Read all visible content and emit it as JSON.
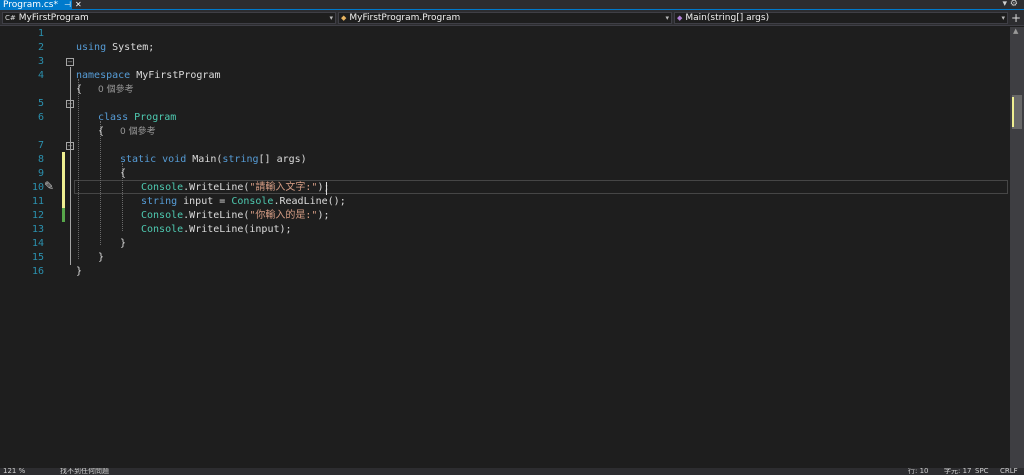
{
  "tab": {
    "title": "Program.cs*",
    "pin_glyph": "⊣",
    "close_glyph": "✕"
  },
  "tabstrip_right": {
    "dropdown_glyph": "▾",
    "gear_glyph": "⚙"
  },
  "navbar": {
    "project": "MyFirstProgram",
    "project_icon": "C#",
    "class": "MyFirstProgram.Program",
    "member": "Main(string[] args)",
    "split_glyph": "+"
  },
  "code": {
    "line_numbers": [
      "1",
      "2",
      "3",
      "4",
      "5",
      "6",
      "7",
      "8",
      "9",
      "10",
      "11",
      "12",
      "13",
      "14",
      "15",
      "16"
    ],
    "codelens_class": "0 個參考",
    "codelens_method": "0 個參考",
    "lines": {
      "l1": {
        "kw": "using",
        "rest": " System;"
      },
      "l3": {
        "kw": "namespace",
        "rest": " MyFirstProgram"
      },
      "l4": "{",
      "l5": {
        "kw": "class",
        "type": "Program"
      },
      "l6": "{",
      "l7": {
        "kw1": "static",
        "kw2": "void",
        "name": "Main(",
        "kw3": "string",
        "rest": "[] args)"
      },
      "l8": "{",
      "l9": {
        "type": "Console",
        "method": ".WriteLine(",
        "str": "\"請輸入文字:\"",
        "end": ");"
      },
      "l10": {
        "kw": "string",
        "mid": " input = ",
        "type": "Console",
        "rest": ".ReadLine();"
      },
      "l11": {
        "type": "Console",
        "method": ".WriteLine(",
        "str": "\"你輸入的是:\"",
        "end": ");"
      },
      "l12": {
        "type": "Console",
        "method": ".WriteLine(input);"
      },
      "l13": "}",
      "l14": "}",
      "l15": "}"
    }
  },
  "statusbar": {
    "zoom": "121 %",
    "issues": "找不到任何問題",
    "line": "行: 10",
    "col": "字元: 17",
    "ch": "SPC",
    "eol": "CRLF"
  },
  "colors": {
    "keyword": "#569cd6",
    "type": "#4ec9b0",
    "string": "#d69d85",
    "line_number": "#2b91af",
    "accent": "#007acc",
    "change_saved": "#57a64a",
    "change_unsaved": "#efef91"
  }
}
